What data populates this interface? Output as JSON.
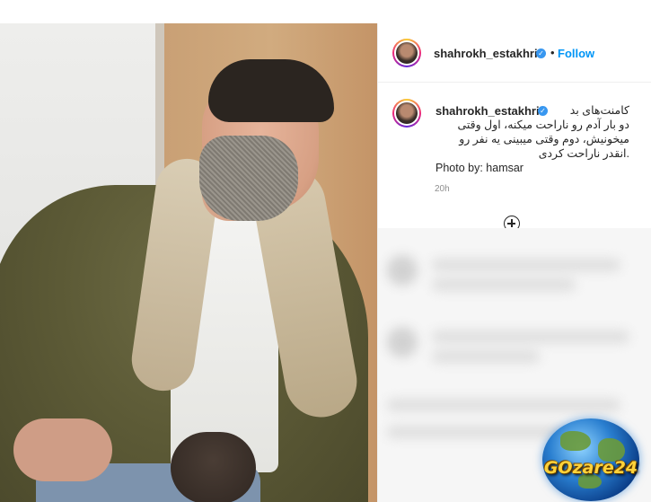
{
  "post": {
    "author": {
      "username": "shahrokh_estakhri",
      "verified": true,
      "follow_label": "Follow",
      "separator": "•"
    },
    "caption": {
      "lines": [
        "کامنت‌های بد",
        "دو بار آدم رو ناراحت میکنه، اول وقتی",
        "میخونیش، دوم وقتی میبینی یه نفر رو",
        ".انقدر ناراحت کردی",
        "Photo by: hamsar"
      ]
    },
    "timestamp": "20h"
  },
  "watermark": {
    "text": "GOzare24"
  },
  "colors": {
    "link_blue": "#0095f6",
    "verified_blue": "#3897f0",
    "text": "#262626",
    "muted": "#8e8e8e"
  },
  "icons": {
    "verified": "verified-badge-icon",
    "add_comment": "plus-circle-icon"
  }
}
